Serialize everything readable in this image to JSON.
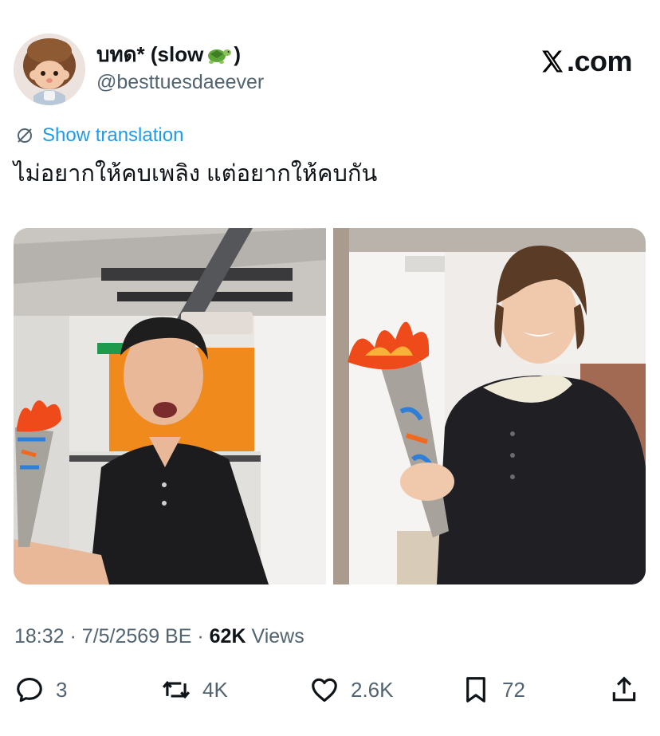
{
  "author": {
    "display_name": "บทด* (slow",
    "display_name_suffix": ")",
    "handle": "@besttuesdaeever",
    "avatar_icon": "monchhichi-avatar",
    "emoji_icon": "turtle-emoji"
  },
  "brand": {
    "logo_text": ".com",
    "logo_icon": "x-logo-icon"
  },
  "translation": {
    "label": "Show translation",
    "icon": "globe-icon"
  },
  "tweet": {
    "text": "ไม่อยากให้คบเพลิง แต่อยากให้คบกัน"
  },
  "media": {
    "photos": [
      {
        "name": "photo-left",
        "description_icon": "man-holding-torch"
      },
      {
        "name": "photo-right",
        "description_icon": "man-holding-torch"
      }
    ]
  },
  "meta": {
    "time": "18:32",
    "date": "7/5/2569 BE",
    "separator": "·",
    "views_count": "62K",
    "views_label": "Views"
  },
  "actions": {
    "reply": {
      "icon": "reply-icon",
      "count": "3"
    },
    "retweet": {
      "icon": "retweet-icon",
      "count": "4K"
    },
    "like": {
      "icon": "heart-icon",
      "count": "2.6K"
    },
    "bookmark": {
      "icon": "bookmark-icon",
      "count": "72"
    },
    "share": {
      "icon": "share-icon"
    }
  },
  "colors": {
    "link": "#1d9bf0",
    "secondary": "#536471",
    "text": "#0f1419"
  }
}
